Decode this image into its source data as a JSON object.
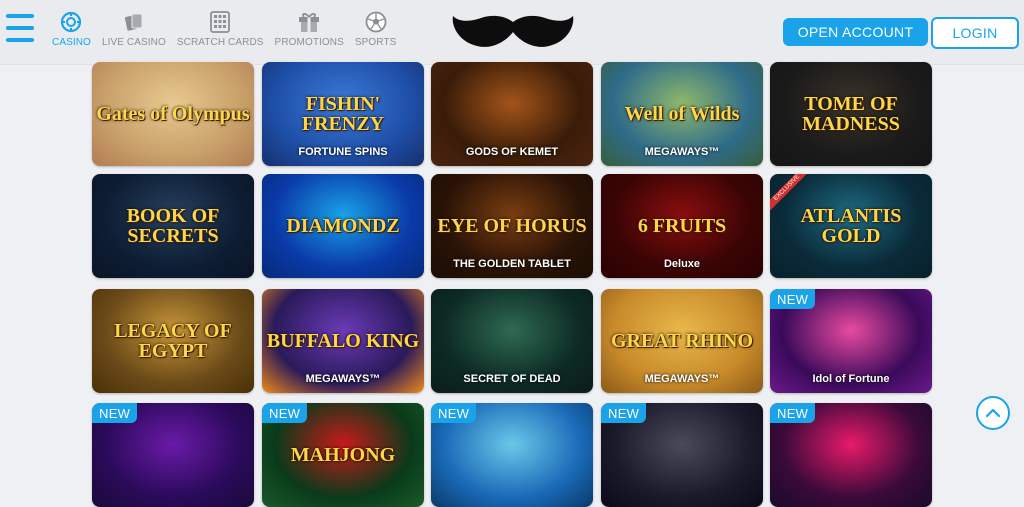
{
  "nav": {
    "items": [
      {
        "label": "CASINO",
        "icon": "casino-chip-icon",
        "active": true
      },
      {
        "label": "LIVE CASINO",
        "icon": "playing-cards-icon",
        "active": false
      },
      {
        "label": "SCRATCH CARDS",
        "icon": "scratch-grid-icon",
        "active": false
      },
      {
        "label": "PROMOTIONS",
        "icon": "gift-box-icon",
        "active": false
      },
      {
        "label": "SPORTS",
        "icon": "football-icon",
        "active": false
      }
    ]
  },
  "header": {
    "logo": "mustache-logo",
    "open_account_label": "OPEN ACCOUNT",
    "login_label": "LOGIN"
  },
  "games": [
    {
      "title": "Gates of Olympus",
      "sub": "",
      "bg": "#c8a06a,#e8c98e,#b27b53",
      "badge": ""
    },
    {
      "title": "FISHIN' FRENZY",
      "sub": "FORTUNE SPINS",
      "bg": "#1e4fa8,#3b7ad8,#16306e",
      "badge": ""
    },
    {
      "title": "",
      "sub": "GODS OF KEMET",
      "bg": "#3a1c08,#a3541a,#4a2410",
      "badge": ""
    },
    {
      "title": "Well of Wilds",
      "sub": "MEGAWAYS™",
      "bg": "#2e6b8a,#8fb86b,#385f3a",
      "badge": ""
    },
    {
      "title": "TOME OF MADNESS",
      "sub": "",
      "bg": "#1a1a1a,#3a3328,#151515",
      "badge": ""
    },
    {
      "title": "BOOK OF SECRETS",
      "sub": "",
      "bg": "#0d1d33,#27405e,#0b1426",
      "badge": ""
    },
    {
      "title": "DIAMONDZ",
      "sub": "",
      "bg": "#0a3aa8,#1aa3e8,#062a7a",
      "badge": ""
    },
    {
      "title": "EYE OF HORUS",
      "sub": "THE GOLDEN TABLET",
      "bg": "#2a1306,#7a3d12,#1a0c04",
      "badge": ""
    },
    {
      "title": "6 FRUITS",
      "sub": "Deluxe",
      "bg": "#3a0404,#8a0e0e,#2a0202",
      "badge": ""
    },
    {
      "title": "ATLANTIS GOLD",
      "sub": "",
      "bg": "#0a2a38,#1d6c82,#08202c",
      "badge": "EXCLUSIVE"
    },
    {
      "title": "LEGACY OF EGYPT",
      "sub": "",
      "bg": "#6a4a18,#c8963a,#4a3008",
      "badge": ""
    },
    {
      "title": "BUFFALO KING",
      "sub": "MEGAWAYS™",
      "bg": "#2a1a5a,#6a3ab8,#f08a1a",
      "badge": ""
    },
    {
      "title": "",
      "sub": "SECRET OF DEAD",
      "bg": "#0d2a24,#2e6a52,#0a1c18",
      "badge": ""
    },
    {
      "title": "GREAT RHINO",
      "sub": "MEGAWAYS™",
      "bg": "#c88a2a,#e8b84a,#8a5a18",
      "badge": ""
    },
    {
      "title": "",
      "sub": "Idol of Fortune",
      "bg": "#3a0a5a,#e84aa0,#6a1a8a",
      "badge": "NEW"
    },
    {
      "title": "",
      "sub": "",
      "bg": "#2a0a5a,#6a1aa8,#1a0a3a",
      "badge": "NEW"
    },
    {
      "title": "MAHJONG",
      "sub": "",
      "bg": "#0a3a1a,#c81a1a,#1a5a2a",
      "badge": "NEW"
    },
    {
      "title": "",
      "sub": "",
      "bg": "#1a6ab8,#6ac8e8,#0a3a6a",
      "badge": "NEW"
    },
    {
      "title": "",
      "sub": "",
      "bg": "#1a1a2a,#4a4a5a,#0a0a1a",
      "badge": "NEW"
    },
    {
      "title": "",
      "sub": "",
      "bg": "#3a0a3a,#e81a6a,#1a0a2a",
      "badge": "NEW"
    }
  ]
}
